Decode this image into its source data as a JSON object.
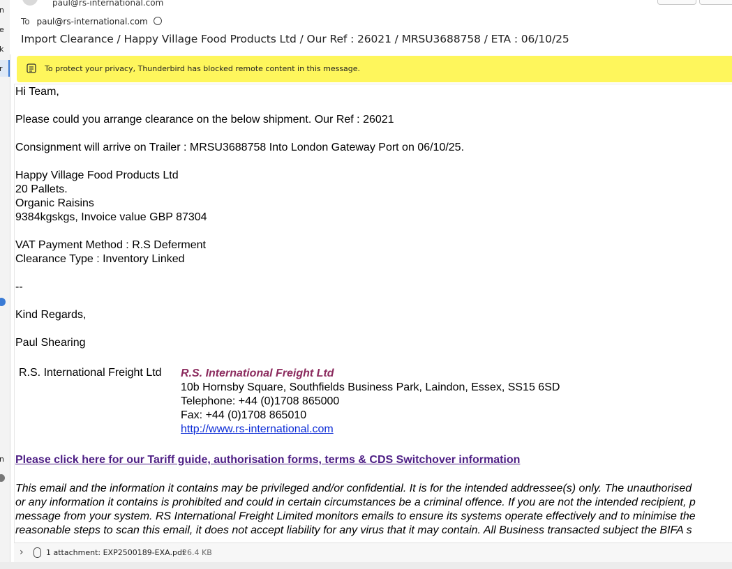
{
  "header": {
    "from": "paul@rs-international.com",
    "to_label": "To",
    "to": "paul@rs-international.com",
    "subject": "Import Clearance / Happy Village Food Products Ltd / Our Ref : 26021 / MRSU3688758 / ETA : 06/10/25"
  },
  "notification": {
    "text": "To protect your privacy, Thunderbird has blocked remote content in this message."
  },
  "body": {
    "greeting": "Hi Team,",
    "line1": "Please could you arrange clearance on the below shipment. Our Ref : 26021",
    "line2": "Consignment will arrive on Trailer : MRSU3688758 Into London Gateway Port on 06/10/25.",
    "company": "Happy Village Food Products Ltd",
    "pallets": "20 Pallets.",
    "product": "Organic Raisins",
    "weight_value": "9384kgskgs, Invoice value GBP 87304",
    "vat": "VAT Payment Method : R.S Deferment",
    "clearance": "Clearance Type : Inventory Linked",
    "separator": "--",
    "regards": "Kind Regards,",
    "sender": "Paul Shearing"
  },
  "signature": {
    "left_name": "R.S. International Freight Ltd",
    "company": "R.S. International Freight Ltd",
    "address": "10b Hornsby Square, Southfields Business Park, Laindon, Essex, SS15 6SD",
    "telephone": "Telephone: +44 (0)1708 865000",
    "fax": "Fax: +44 (0)1708 865010",
    "website": "http://www.rs-international.com"
  },
  "tariff_link": "Please click here for our Tariff guide, authorisation forms, terms & CDS Switchover information",
  "disclaimer": [
    "This email and the information it contains may be privileged and/or confidential. It is for the intended addressee(s) only. The unauthorised",
    "or any information it contains is prohibited and could in certain circumstances be a criminal offence. If you are not the intended recipient, p",
    "message from your system. RS International Freight Limited monitors emails to ensure its systems operate effectively and to minimise the",
    "reasonable steps to scan this email, it does not accept liability for any virus that it may contain. All Business transacted subject the BIFA s"
  ],
  "attachment": {
    "label": "1 attachment: EXP2500189-EXA.pdf",
    "size": "26.4 KB"
  },
  "left_fragments": [
    "n",
    "e",
    "k",
    "r",
    "n"
  ],
  "colors": {
    "notification_bg": "#fef65c",
    "signature_company": "#8b2a5d",
    "link": "#0b2bd6",
    "tariff_link": "#4d1e84"
  }
}
